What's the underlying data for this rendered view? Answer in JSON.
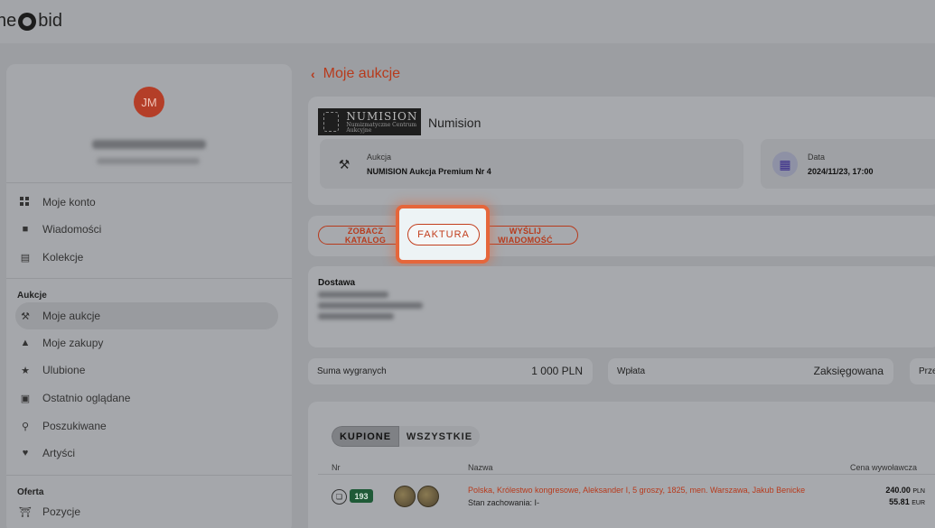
{
  "logo": {
    "left": "ne",
    "right": "bid"
  },
  "user": {
    "initials": "JM"
  },
  "sidebar": {
    "items_top": [
      {
        "label": "Moje konto",
        "icon": "dashboard-icon"
      },
      {
        "label": "Wiadomości",
        "icon": "chat-icon"
      },
      {
        "label": "Kolekcje",
        "icon": "collections-icon"
      }
    ],
    "section_aukcje": "Aukcje",
    "items_aukcje": [
      {
        "label": "Moje aukcje",
        "icon": "gavel-icon",
        "active": true
      },
      {
        "label": "Moje zakupy",
        "icon": "basket-icon"
      },
      {
        "label": "Ulubione",
        "icon": "star-icon"
      },
      {
        "label": "Ostatnio oglądane",
        "icon": "history-icon"
      },
      {
        "label": "Poszukiwane",
        "icon": "search-icon"
      },
      {
        "label": "Artyści",
        "icon": "heart-icon"
      }
    ],
    "section_oferta": "Oferta",
    "items_oferta": [
      {
        "label": "Pozycje",
        "icon": "bank-icon"
      }
    ]
  },
  "main": {
    "back_label": "Moje aukcje",
    "brand": {
      "logo_text": "NUMISION",
      "logo_sub": "Numizmatyczne Centrum Aukcyjne",
      "name": "Numision"
    },
    "auction": {
      "label": "Aukcja",
      "value": "NUMISION Aukcja Premium Nr 4"
    },
    "date": {
      "label": "Data",
      "value": "2024/11/23, 17:00"
    },
    "actions": {
      "catalog": "ZOBACZ KATALOG",
      "invoice": "FAKTURA",
      "message": "WYŚLIJ WIADOMOŚĆ"
    },
    "delivery_title": "Dostawa",
    "summary": [
      {
        "label": "Suma wygranych",
        "value": "1 000 PLN"
      },
      {
        "label": "Wpłata",
        "value": "Zaksięgowana"
      },
      {
        "label": "Prze",
        "value": ""
      }
    ],
    "tabs": {
      "bought": "KUPIONE",
      "all": "WSZYSTKIE"
    },
    "table": {
      "headers": {
        "nr": "Nr",
        "name": "Nazwa",
        "price": "Cena wywoławcza"
      },
      "rows": [
        {
          "number": "193",
          "name": "Polska, Królestwo kongresowe, Aleksander I, 5 groszy, 1825, men. Warszawa, Jakub Benicke",
          "state": "Stan zachowania: I-",
          "price_pln": "240.00",
          "currency_pln": "PLN",
          "price_eur": "55.81",
          "currency_eur": "EUR"
        }
      ]
    }
  },
  "colors": {
    "accent": "#b73a1c",
    "highlight_border": "#e5663b",
    "badge": "#1f5a37",
    "avatar": "#b43e28"
  }
}
